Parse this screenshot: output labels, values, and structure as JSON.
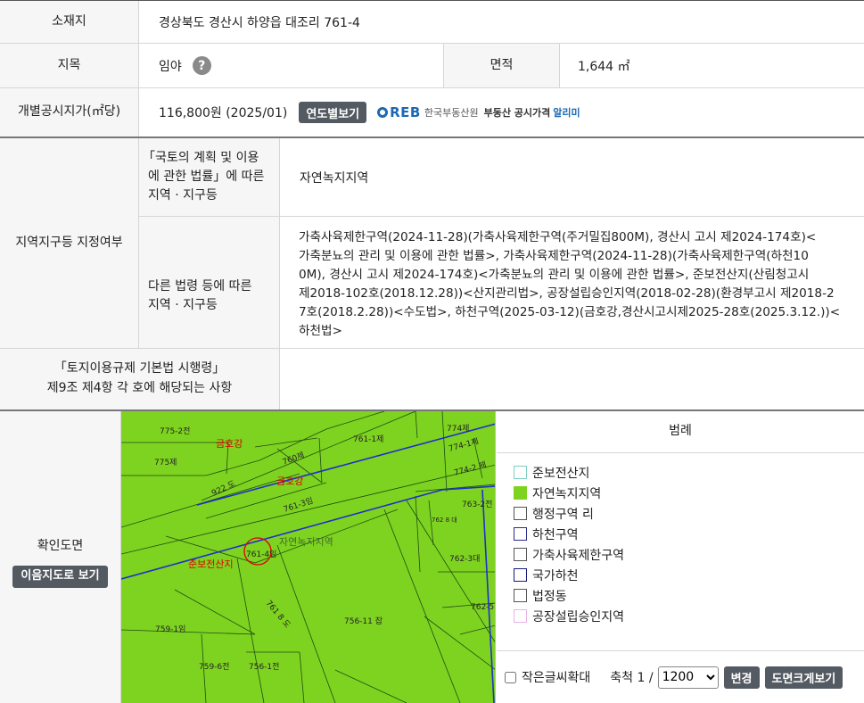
{
  "rows": {
    "location": {
      "label": "소재지",
      "value": "경상북도 경산시 하양읍 대조리 761-4"
    },
    "land_category": {
      "label": "지목",
      "value": "임야",
      "help": "?"
    },
    "area": {
      "label": "면적",
      "value": "1,644 ㎡"
    },
    "price": {
      "label": "개별공시지가(㎡당)",
      "value": "116,800원 (2025/01)",
      "yearly_button": "연도별보기"
    },
    "zone": {
      "label": "지역지구등 지정여부",
      "planning_law_label_lines": [
        "「국토의 계획 및 이용",
        "에 관한 법률」에 따른",
        "지역 · 지구등"
      ],
      "planning_law_value": "자연녹지지역",
      "other_law_label_lines": [
        "다른 법령 등에 따른",
        "지역 · 지구등"
      ],
      "other_law_value_lines": [
        "가축사육제한구역(2024-11-28)(가축사육제한구역(주거밀집800M), 경산시 고시 제2024-174호)<",
        "가축분뇨의 관리 및 이용에 관한 법률>, 가축사육제한구역(2024-11-28)(가축사육제한구역(하천10",
        "0M), 경산시 고시 제2024-174호)<가축분뇨의 관리 및 이용에 관한 법률>, 준보전산지(산림청고시",
        "제2018-102호(2018.12.28))<산지관리법>, 공장설립승인지역(2018-02-28)(환경부고시 제2018-2",
        "7호(2018.2.28))<수도법>, 하천구역(2025-03-12)(금호강,경산시고시제2025-28호(2025.3.12.))<",
        "하천법>"
      ]
    },
    "enforcement": {
      "label_lines": [
        "「토지이용규제 기본법 시행령」",
        "제9조 제4항 각 호에 해당되는 사항"
      ],
      "value": ""
    }
  },
  "reb": {
    "logo": "REB",
    "org": "한국부동산원",
    "service": "부동산 공시가격",
    "service_accent": "알리미"
  },
  "map_section": {
    "label": "확인도면",
    "view_button": "이음지도로 보기",
    "map_labels": {
      "parcels": [
        "775-2전",
        "775제",
        "760제",
        "761-1제",
        "774제",
        "774-1제",
        "774-2 제",
        "763-2전",
        "762 8 대",
        "762-3대",
        "762-5전",
        "761-3임",
        "761-4임",
        "761 8 도",
        "756-11 잡",
        "759-1임",
        "759-6전",
        "756-1전",
        "922 도"
      ],
      "zones": [
        "금호강",
        "금호강",
        "자연녹지지역",
        "준보전산지"
      ]
    }
  },
  "legend": {
    "title": "범례",
    "items": [
      {
        "label": "준보전산지",
        "fill": "#ffffff",
        "border": "#7fcfc4"
      },
      {
        "label": "자연녹지지역",
        "fill": "#7ed321",
        "border": "#7ed321"
      },
      {
        "label": "행정구역 리",
        "fill": "#ffffff",
        "border": "#555555"
      },
      {
        "label": "하천구역",
        "fill": "#ffffff",
        "border": "#2b2b8a"
      },
      {
        "label": "가축사육제한구역",
        "fill": "#ffffff",
        "border": "#555555"
      },
      {
        "label": "국가하천",
        "fill": "#ffffff",
        "border": "#1a1a7a"
      },
      {
        "label": "법정동",
        "fill": "#ffffff",
        "border": "#555555"
      },
      {
        "label": "공장설립승인지역",
        "fill": "#ffffff",
        "border": "#e7b4e4"
      }
    ]
  },
  "controls": {
    "small_text_label": "작은글씨확대",
    "scale_label": "축척 1 /",
    "scale_value": "1200",
    "change_button": "변경",
    "enlarge_button": "도면크게보기"
  },
  "colors": {
    "map_green": "#7ed321",
    "header_bg": "#f6f6f6",
    "button_dark": "#545a62",
    "reb_blue": "#1d68b3"
  }
}
